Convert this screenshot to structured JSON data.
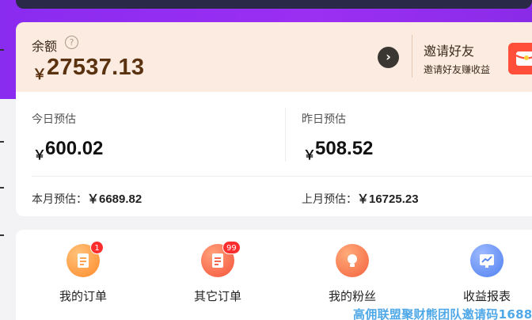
{
  "balance": {
    "label": "余额",
    "help_glyph": "?",
    "currency": "￥",
    "amount": "27537.13"
  },
  "invite": {
    "title": "邀请好友",
    "subtitle": "邀请好友赚收益",
    "arrow_glyph": "›"
  },
  "estimates": {
    "today": {
      "label": "今日预估",
      "currency": "￥",
      "value": "600.02"
    },
    "yesterday": {
      "label": "昨日预估",
      "currency": "￥",
      "value": "508.52"
    },
    "this_month": {
      "label": "本月预估：",
      "value": "￥6689.82"
    },
    "last_month": {
      "label": "上月预估：",
      "value": "￥16725.23"
    }
  },
  "menu": {
    "items": [
      {
        "label": "我的订单",
        "badge": "1",
        "icon": "order-icon",
        "color": "#ff9a3c"
      },
      {
        "label": "其它订单",
        "badge": "99",
        "icon": "other-order-icon",
        "color": "#ff6a4a"
      },
      {
        "label": "我的粉丝",
        "badge": "",
        "icon": "fans-icon",
        "color": "#ff7a4e"
      },
      {
        "label": "收益报表",
        "badge": "",
        "icon": "report-icon",
        "color": "#5b8cf5"
      }
    ]
  },
  "watermark": "高佣联盟聚财熊团队邀请码1688",
  "colors": {
    "header_purple": "#9b2ff2",
    "balance_bg": "#fcebe0",
    "balance_text": "#5a3210",
    "badge_red": "#ff2e2e",
    "gift_red": "#ff4e3a",
    "watermark_blue": "#4fa8e8"
  }
}
